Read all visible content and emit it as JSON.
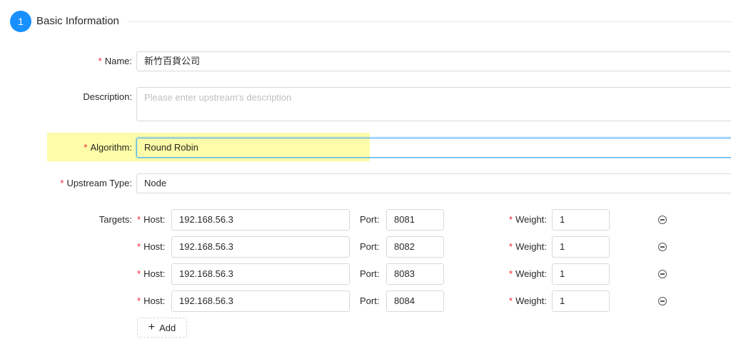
{
  "step": {
    "number": "1",
    "title": "Basic Information"
  },
  "form": {
    "name": {
      "label": "Name:",
      "value": "新竹百貨公司"
    },
    "description": {
      "label": "Description:",
      "placeholder": "Please enter upstream's description"
    },
    "algorithm": {
      "label": "Algorithm:",
      "value": "Round Robin"
    },
    "upstream_type": {
      "label": "Upstream Type:",
      "value": "Node"
    },
    "targets": {
      "label": "Targets:",
      "host_label": "Host:",
      "port_label": "Port:",
      "weight_label": "Weight:",
      "rows": [
        {
          "host": "192.168.56.3",
          "port": "8081",
          "weight": "1"
        },
        {
          "host": "192.168.56.3",
          "port": "8082",
          "weight": "1"
        },
        {
          "host": "192.168.56.3",
          "port": "8083",
          "weight": "1"
        },
        {
          "host": "192.168.56.3",
          "port": "8084",
          "weight": "1"
        }
      ],
      "add_label": "Add"
    }
  },
  "colors": {
    "accent": "#1890ff",
    "required": "#f5222d",
    "highlight": "#fbfb9a"
  },
  "icons": {
    "remove": "minus-circle-icon",
    "add": "plus-icon"
  }
}
